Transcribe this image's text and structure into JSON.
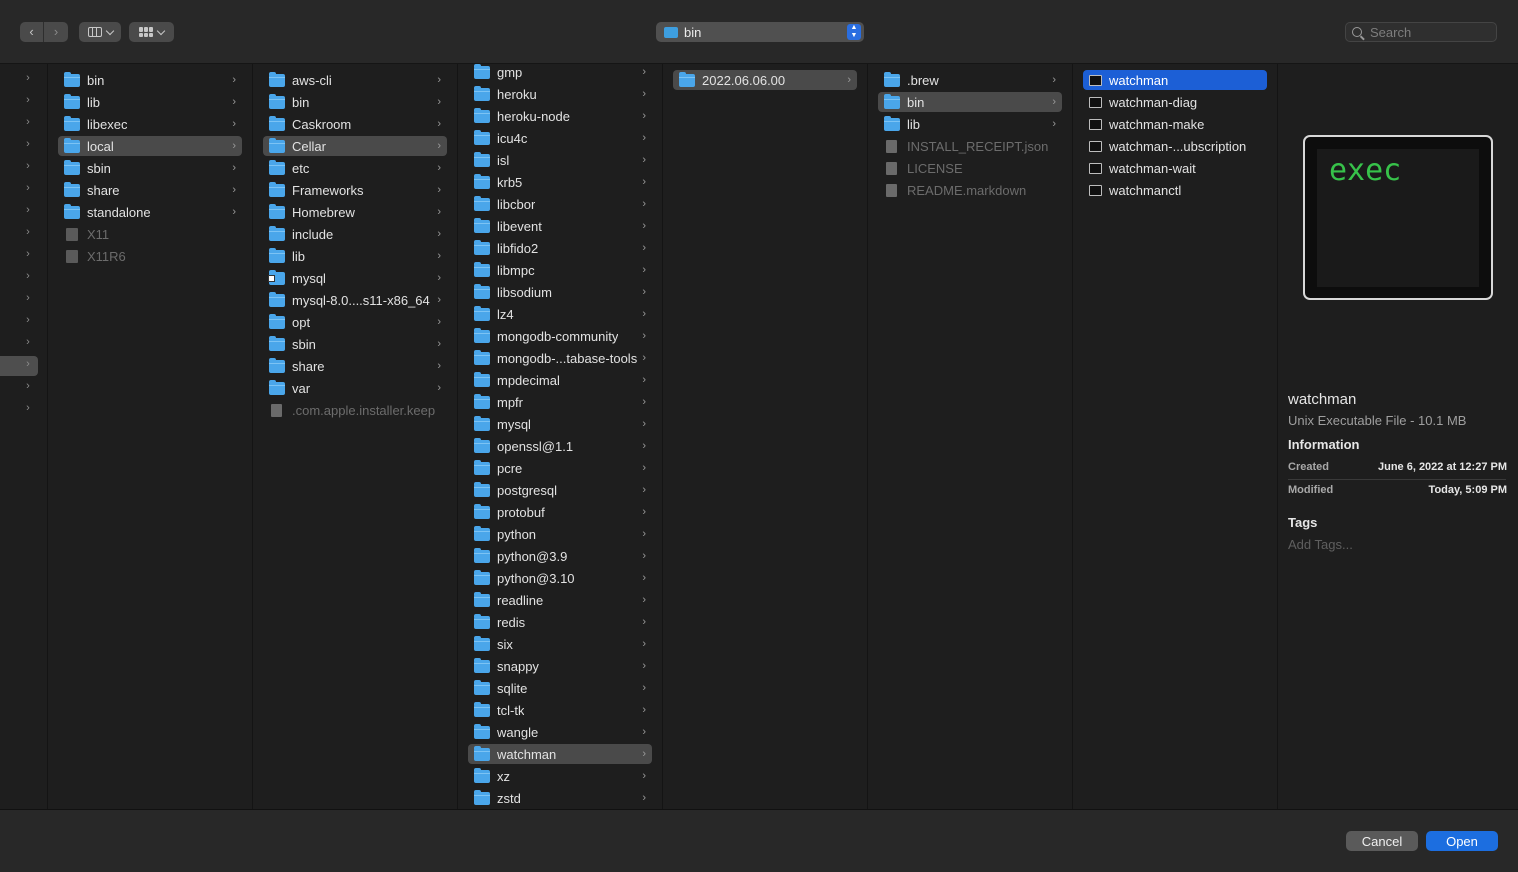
{
  "toolbar": {
    "back_glyph": "‹",
    "forward_glyph": "›",
    "location": "bin",
    "search_placeholder": "Search",
    "icons": [
      "chevron-left-icon",
      "chevron-right-icon",
      "columns-view-icon",
      "grid-view-icon",
      "folder-icon",
      "stepper-icon",
      "search-icon"
    ]
  },
  "columns": {
    "col1": [
      {
        "name": "bin",
        "type": "folder"
      },
      {
        "name": "lib",
        "type": "folder"
      },
      {
        "name": "libexec",
        "type": "folder"
      },
      {
        "name": "local",
        "type": "folder",
        "selected": "gray"
      },
      {
        "name": "sbin",
        "type": "folder"
      },
      {
        "name": "share",
        "type": "folder"
      },
      {
        "name": "standalone",
        "type": "folder"
      },
      {
        "name": "X11",
        "type": "alias",
        "dim": true
      },
      {
        "name": "X11R6",
        "type": "alias",
        "dim": true
      }
    ],
    "col2": [
      {
        "name": "aws-cli",
        "type": "folder"
      },
      {
        "name": "bin",
        "type": "folder"
      },
      {
        "name": "Caskroom",
        "type": "folder"
      },
      {
        "name": "Cellar",
        "type": "folder",
        "selected": "gray"
      },
      {
        "name": "etc",
        "type": "folder"
      },
      {
        "name": "Frameworks",
        "type": "folder"
      },
      {
        "name": "Homebrew",
        "type": "folder"
      },
      {
        "name": "include",
        "type": "folder"
      },
      {
        "name": "lib",
        "type": "folder"
      },
      {
        "name": "mysql",
        "type": "folder-alias"
      },
      {
        "name": "mysql-8.0....s11-x86_64",
        "type": "folder"
      },
      {
        "name": "opt",
        "type": "folder"
      },
      {
        "name": "sbin",
        "type": "folder"
      },
      {
        "name": "share",
        "type": "folder"
      },
      {
        "name": "var",
        "type": "folder"
      },
      {
        "name": ".com.apple.installer.keep",
        "type": "doc",
        "dim": true
      }
    ],
    "col3": [
      {
        "name": "gmp",
        "type": "folder"
      },
      {
        "name": "heroku",
        "type": "folder"
      },
      {
        "name": "heroku-node",
        "type": "folder"
      },
      {
        "name": "icu4c",
        "type": "folder"
      },
      {
        "name": "isl",
        "type": "folder"
      },
      {
        "name": "krb5",
        "type": "folder"
      },
      {
        "name": "libcbor",
        "type": "folder"
      },
      {
        "name": "libevent",
        "type": "folder"
      },
      {
        "name": "libfido2",
        "type": "folder"
      },
      {
        "name": "libmpc",
        "type": "folder"
      },
      {
        "name": "libsodium",
        "type": "folder"
      },
      {
        "name": "lz4",
        "type": "folder"
      },
      {
        "name": "mongodb-community",
        "type": "folder"
      },
      {
        "name": "mongodb-...tabase-tools",
        "type": "folder"
      },
      {
        "name": "mpdecimal",
        "type": "folder"
      },
      {
        "name": "mpfr",
        "type": "folder"
      },
      {
        "name": "mysql",
        "type": "folder"
      },
      {
        "name": "openssl@1.1",
        "type": "folder"
      },
      {
        "name": "pcre",
        "type": "folder"
      },
      {
        "name": "postgresql",
        "type": "folder"
      },
      {
        "name": "protobuf",
        "type": "folder"
      },
      {
        "name": "python",
        "type": "folder"
      },
      {
        "name": "python@3.9",
        "type": "folder"
      },
      {
        "name": "python@3.10",
        "type": "folder"
      },
      {
        "name": "readline",
        "type": "folder"
      },
      {
        "name": "redis",
        "type": "folder"
      },
      {
        "name": "six",
        "type": "folder"
      },
      {
        "name": "snappy",
        "type": "folder"
      },
      {
        "name": "sqlite",
        "type": "folder"
      },
      {
        "name": "tcl-tk",
        "type": "folder"
      },
      {
        "name": "wangle",
        "type": "folder"
      },
      {
        "name": "watchman",
        "type": "folder",
        "selected": "gray"
      },
      {
        "name": "xz",
        "type": "folder"
      },
      {
        "name": "zstd",
        "type": "folder"
      }
    ],
    "col4": [
      {
        "name": "2022.06.06.00",
        "type": "folder",
        "selected": "gray"
      }
    ],
    "col5": [
      {
        "name": ".brew",
        "type": "folder"
      },
      {
        "name": "bin",
        "type": "folder",
        "selected": "gray"
      },
      {
        "name": "lib",
        "type": "folder"
      },
      {
        "name": "INSTALL_RECEIPT.json",
        "type": "doc",
        "dim": true
      },
      {
        "name": "LICENSE",
        "type": "doc",
        "dim": true
      },
      {
        "name": "README.markdown",
        "type": "doc",
        "dim": true
      }
    ],
    "col6": [
      {
        "name": "watchman",
        "type": "exec",
        "selected": "blue"
      },
      {
        "name": "watchman-diag",
        "type": "exec"
      },
      {
        "name": "watchman-make",
        "type": "exec"
      },
      {
        "name": "watchman-...ubscription",
        "type": "exec"
      },
      {
        "name": "watchman-wait",
        "type": "exec"
      },
      {
        "name": "watchmanctl",
        "type": "exec"
      }
    ]
  },
  "preview": {
    "thumbnail_text": "exec",
    "name": "watchman",
    "kind": "Unix Executable File - 10.1 MB",
    "info_heading": "Information",
    "created_label": "Created",
    "created_value": "June 6, 2022 at 12:27 PM",
    "modified_label": "Modified",
    "modified_value": "Today, 5:09 PM",
    "tags_heading": "Tags",
    "add_tags": "Add Tags..."
  },
  "footer": {
    "cancel_label": "Cancel",
    "open_label": "Open"
  },
  "colors": {
    "accent": "#1c6ee0",
    "selection_blue": "#1c5fd6",
    "folder": "#4aa6ea",
    "exec_green": "#37c24a"
  }
}
